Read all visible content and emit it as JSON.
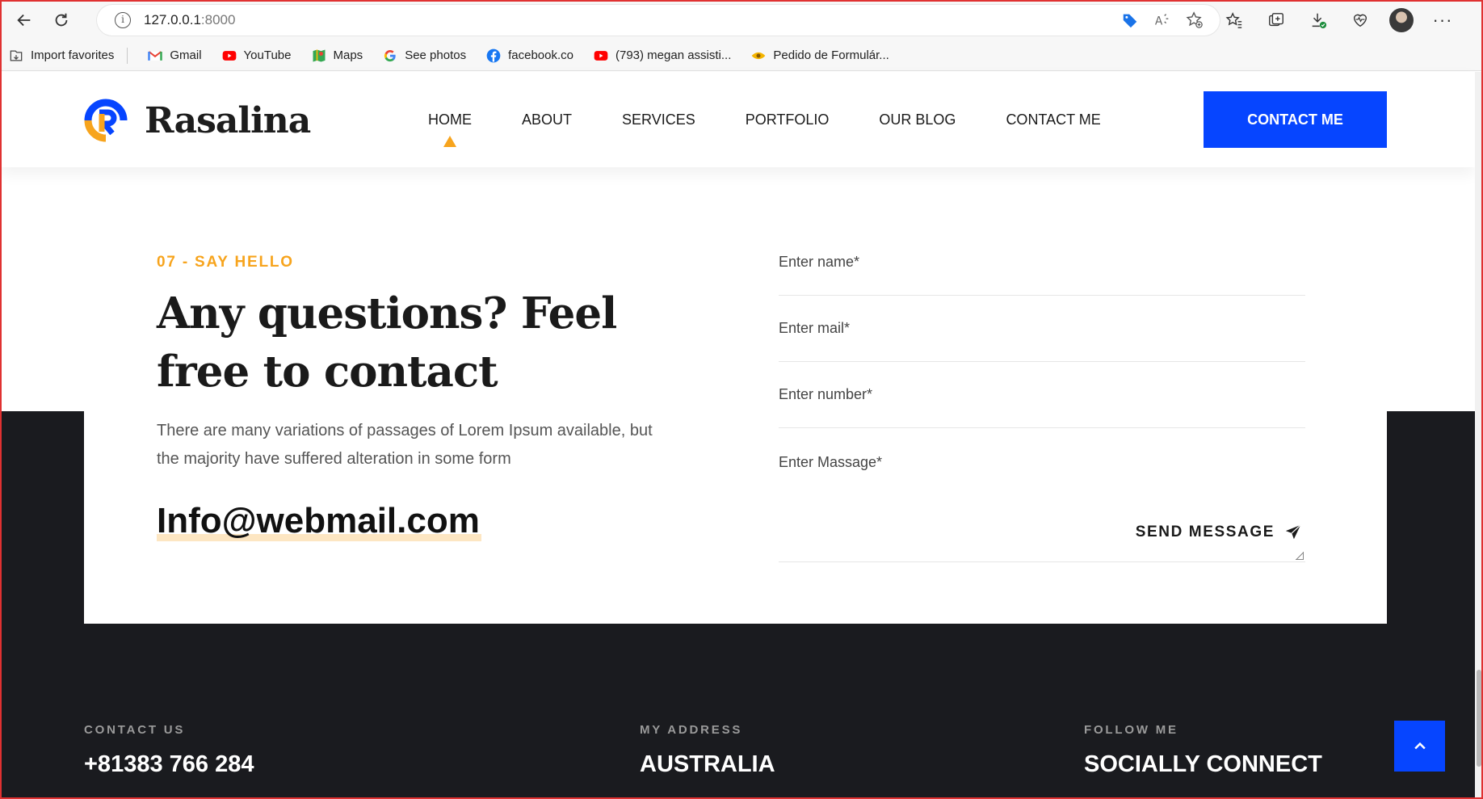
{
  "browser": {
    "url_host": "127.0.0.1",
    "url_port": ":8000",
    "bookmarks": [
      {
        "label": "Import favorites",
        "icon": "import-icon"
      },
      {
        "label": "Gmail",
        "icon": "gmail-icon"
      },
      {
        "label": "YouTube",
        "icon": "youtube-icon"
      },
      {
        "label": "Maps",
        "icon": "maps-icon"
      },
      {
        "label": "See photos",
        "icon": "google-icon"
      },
      {
        "label": "facebook.co",
        "icon": "facebook-icon"
      },
      {
        "label": "(793) megan assisti...",
        "icon": "youtube-icon"
      },
      {
        "label": "Pedido de Formulár...",
        "icon": "eye-icon"
      }
    ]
  },
  "site": {
    "brand": "Rasalina",
    "nav": [
      "HOME",
      "ABOUT",
      "SERVICES",
      "PORTFOLIO",
      "OUR BLOG",
      "CONTACT ME"
    ],
    "active_nav": "HOME",
    "cta": "CONTACT ME",
    "colors": {
      "accent_blue": "#0645ff",
      "accent_orange": "#f7a41d",
      "dark_bg": "#1a1b1f"
    }
  },
  "contact": {
    "eyebrow": "07 - SAY HELLO",
    "title": "Any questions? Feel free to contact",
    "description": "There are many variations of passages of Lorem Ipsum available, but the majority have suffered alteration in some form",
    "email": "Info@webmail.com",
    "form": {
      "name_placeholder": "Enter name*",
      "mail_placeholder": "Enter mail*",
      "number_placeholder": "Enter number*",
      "message_placeholder": "Enter Massage*",
      "submit_label": "SEND MESSAGE"
    }
  },
  "footer": {
    "contact_label": "CONTACT US",
    "contact_value": "+81383 766 284",
    "address_label": "MY ADDRESS",
    "address_value": "AUSTRALIA",
    "follow_label": "FOLLOW ME",
    "follow_value": "SOCIALLY CONNECT"
  }
}
